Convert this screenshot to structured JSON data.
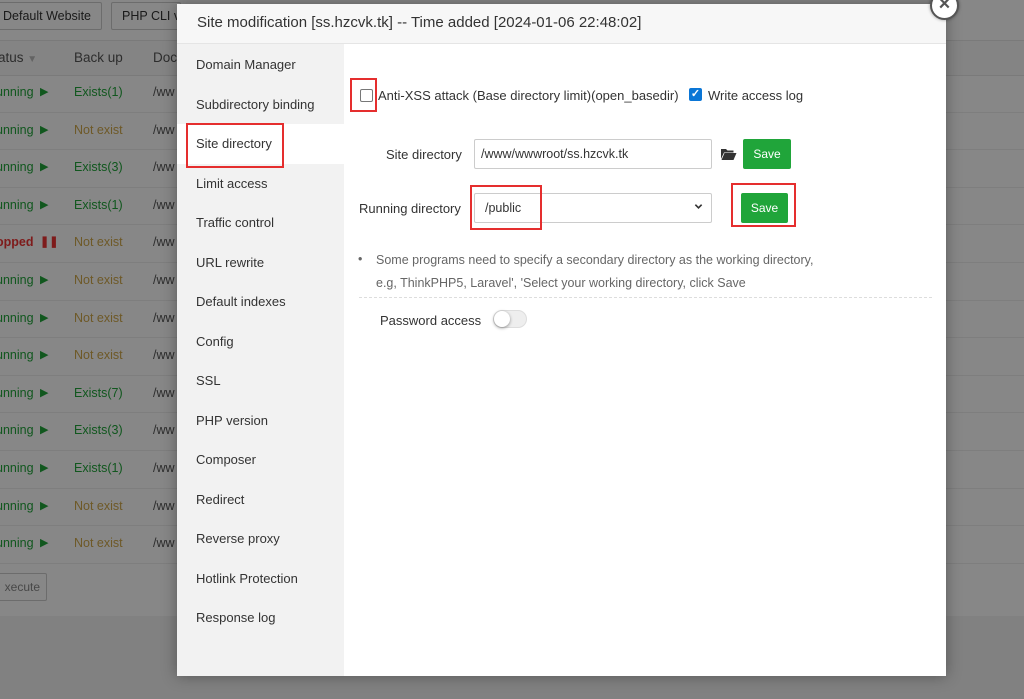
{
  "background": {
    "toolbar": {
      "default_website_label": "Default Website",
      "php_cli_label": "PHP CLI v"
    },
    "table": {
      "headers": {
        "status": "atus",
        "backup": "Back up",
        "doc": "Doc"
      },
      "rows": [
        {
          "status": "unning",
          "status_icon": "play",
          "backup": "Exists(1)",
          "doc": "/ww"
        },
        {
          "status": "unning",
          "status_icon": "play",
          "backup": "Not exist",
          "doc": "/ww"
        },
        {
          "status": "unning",
          "status_icon": "play",
          "backup": "Exists(3)",
          "doc": "/ww"
        },
        {
          "status": "unning",
          "status_icon": "play",
          "backup": "Exists(1)",
          "doc": "/ww"
        },
        {
          "status": "opped",
          "status_icon": "pause",
          "backup": "Not exist",
          "doc": "/ww"
        },
        {
          "status": "unning",
          "status_icon": "play",
          "backup": "Not exist",
          "doc": "/ww"
        },
        {
          "status": "unning",
          "status_icon": "play",
          "backup": "Not exist",
          "doc": "/ww"
        },
        {
          "status": "unning",
          "status_icon": "play",
          "backup": "Not exist",
          "doc": "/ww"
        },
        {
          "status": "unning",
          "status_icon": "play",
          "backup": "Exists(7)",
          "doc": "/ww"
        },
        {
          "status": "unning",
          "status_icon": "play",
          "backup": "Exists(3)",
          "doc": "/ww"
        },
        {
          "status": "unning",
          "status_icon": "play",
          "backup": "Exists(1)",
          "doc": "/ww"
        },
        {
          "status": "unning",
          "status_icon": "play",
          "backup": "Not exist",
          "doc": "/ww"
        },
        {
          "status": "unning",
          "status_icon": "play",
          "backup": "Not exist",
          "doc": "/ww"
        }
      ],
      "execute_label": "xecute"
    }
  },
  "dialog": {
    "title": "Site modification [ss.hzcvk.tk] -- Time added [2024-01-06 22:48:02]",
    "sidebar": [
      {
        "label": "Domain Manager"
      },
      {
        "label": "Subdirectory binding"
      },
      {
        "label": "Site directory",
        "active": true
      },
      {
        "label": "Limit access"
      },
      {
        "label": "Traffic control"
      },
      {
        "label": "URL rewrite"
      },
      {
        "label": "Default indexes"
      },
      {
        "label": "Config"
      },
      {
        "label": "SSL"
      },
      {
        "label": "PHP version"
      },
      {
        "label": "Composer"
      },
      {
        "label": "Redirect"
      },
      {
        "label": "Reverse proxy"
      },
      {
        "label": "Hotlink Protection"
      },
      {
        "label": "Response log"
      }
    ],
    "site_directory": {
      "anti_xss": {
        "label": "Anti-XSS attack (Base directory limit)(open_basedir)",
        "checked": false
      },
      "write_log": {
        "label": "Write access log",
        "checked": true
      },
      "site_dir_label": "Site directory",
      "site_dir_value": "/www/wwwroot/ss.hzcvk.tk",
      "save_label": "Save",
      "running_dir_label": "Running directory",
      "running_dir_value": "/public",
      "running_save_label": "Save",
      "tip_line1": "Some programs need to specify a secondary directory as the working directory,",
      "tip_line2": "e.g, ThinkPHP5, Laravel', 'Select your working directory, click Save",
      "password_access_label": "Password access",
      "password_access_enabled": false
    }
  },
  "colors": {
    "accent_green": "#20a53a",
    "highlight_red": "#e52e2e",
    "checkbox_blue": "#0b76d6"
  }
}
